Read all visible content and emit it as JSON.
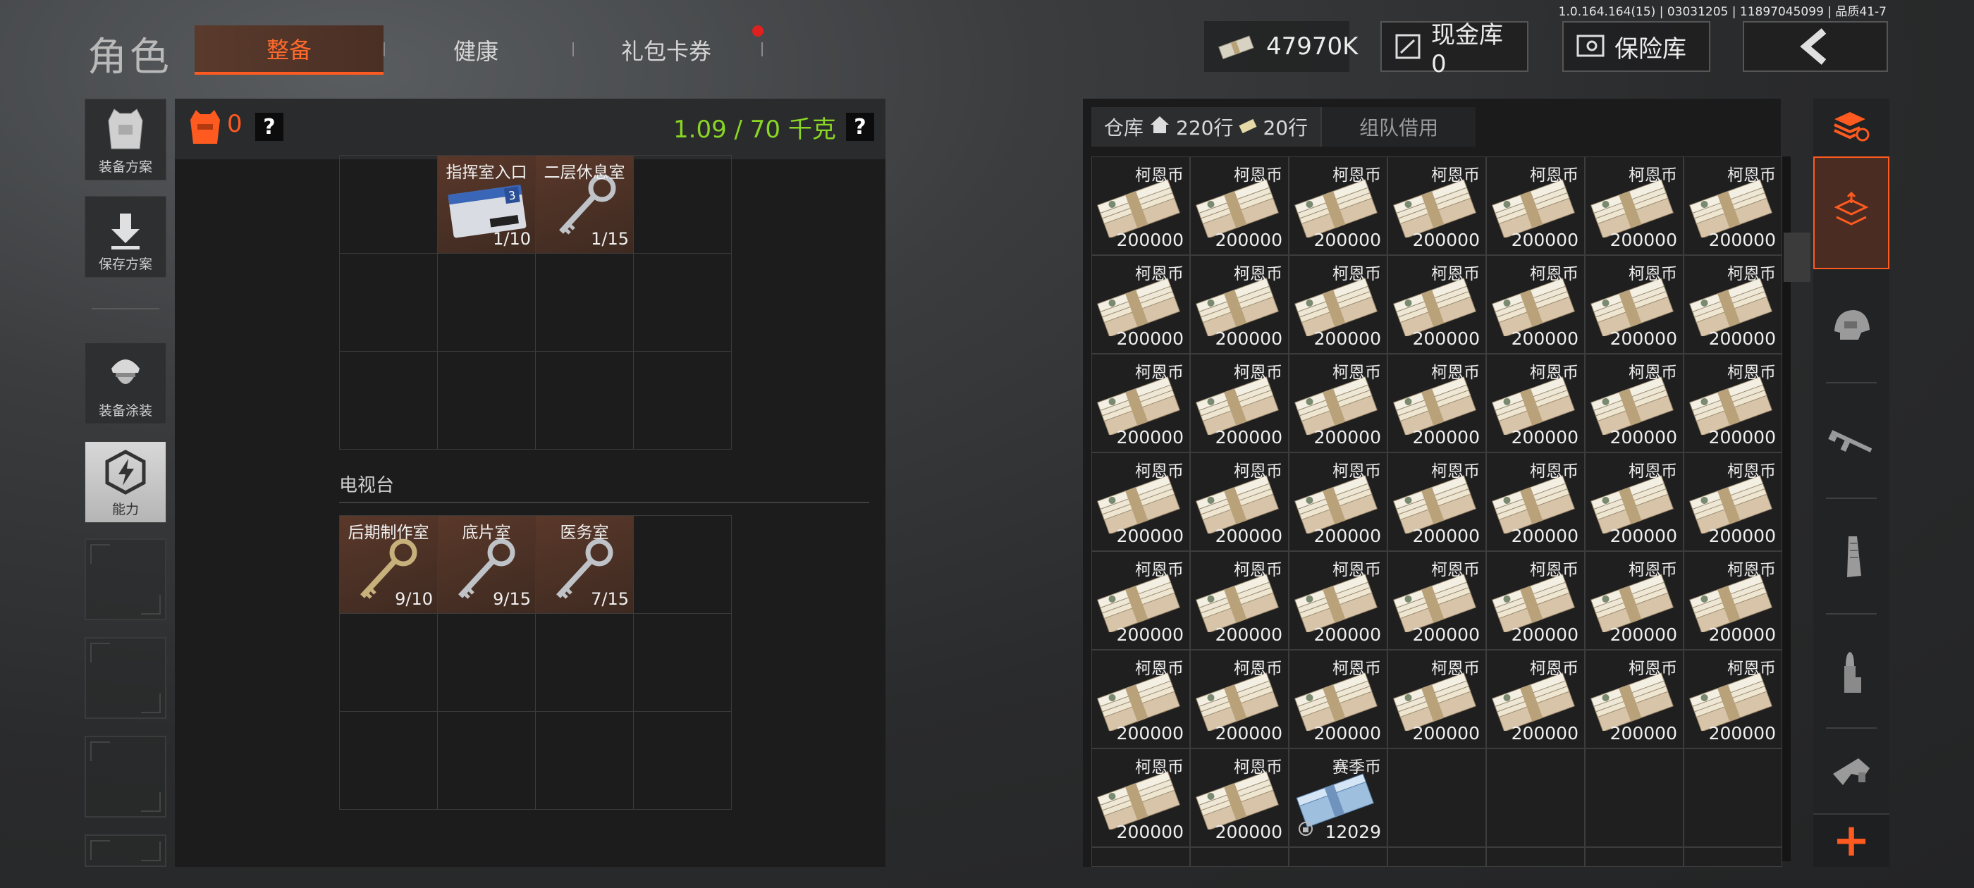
{
  "version": "1.0.164.164(15) | 03031205 | 11897045099 | 品质41-7",
  "header": {
    "title": "角色",
    "tabs": [
      {
        "label": "整备",
        "active": true
      },
      {
        "label": "健康",
        "active": false
      },
      {
        "label": "礼包卡券",
        "active": false,
        "has_notification": true
      }
    ],
    "currency": "47970K",
    "cash_vault": "现金库 0",
    "safe_box": "保险库"
  },
  "left_tools": [
    {
      "label": "装备方案",
      "icon": "vest-icon"
    },
    {
      "label": "保存方案",
      "icon": "download-icon"
    },
    {
      "label": "装备涂装",
      "icon": "helmet-soldier-icon"
    },
    {
      "label": "能力",
      "icon": "ability-hex-icon"
    }
  ],
  "loadout": {
    "vest_count": "0",
    "weight": "1.09 / 70 千克",
    "help": "?",
    "top_items": [
      {
        "name": "指挥室入口",
        "count": "1/10",
        "type": "keycard"
      },
      {
        "name": "二层休息室",
        "count": "1/15",
        "type": "key"
      }
    ],
    "section_title": "电视台",
    "section_items": [
      {
        "name": "后期制作室",
        "count": "9/10",
        "type": "key"
      },
      {
        "name": "底片室",
        "count": "9/15",
        "type": "key"
      },
      {
        "name": "医务室",
        "count": "7/15",
        "type": "key"
      }
    ]
  },
  "warehouse": {
    "tab_label": "仓库",
    "rows": "220行",
    "tickets": "20行",
    "team_tab": "组队借用",
    "item_name": "柯恩币",
    "item_value": "200000",
    "item_count": 44,
    "special_item": {
      "name": "赛季币",
      "value": "12029"
    }
  },
  "category_column": {
    "items": [
      "stack-refresh-icon",
      "stack-up-icon",
      "helmet-icon",
      "rifle-icon",
      "magazine-icon",
      "bullet-icon",
      "misc-gear-icon"
    ],
    "add_label": "+"
  },
  "colors": {
    "accent": "#ff5a1f",
    "weight_green": "#8ad624",
    "item_bg": "#4a3025"
  }
}
